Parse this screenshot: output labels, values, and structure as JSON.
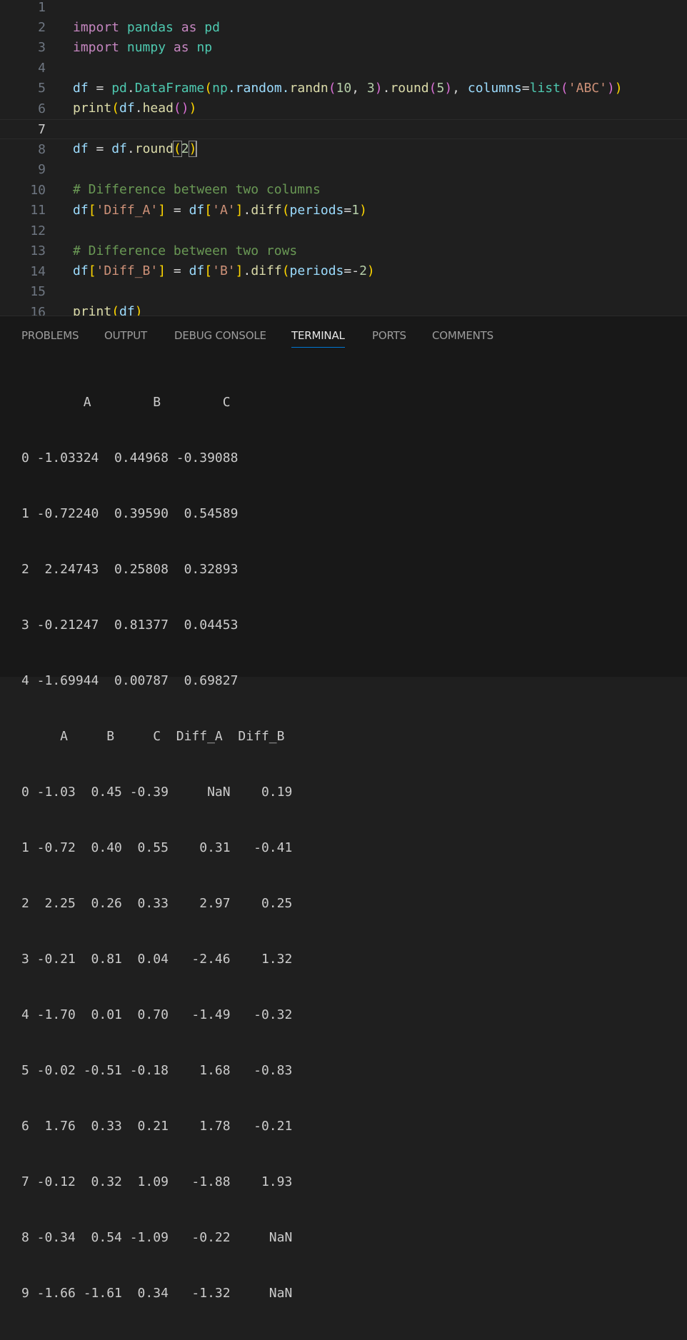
{
  "editor": {
    "line_numbers": [
      "1",
      "2",
      "3",
      "4",
      "5",
      "6",
      "7",
      "8",
      "9",
      "10",
      "11",
      "12",
      "13",
      "14",
      "15",
      "16"
    ],
    "active_line": "7",
    "lines": {
      "l1": {
        "t1": "import",
        "t2": "pandas",
        "t3": "as",
        "t4": "pd"
      },
      "l2": {
        "t1": "import",
        "t2": "numpy",
        "t3": "as",
        "t4": "np"
      },
      "l4": {
        "t1": "df",
        "t2": " = ",
        "t3": "pd",
        "t4": ".",
        "t5": "DataFrame",
        "t6": "(",
        "t7": "np",
        "t8": ".random.",
        "t9": "randn",
        "t10": "(",
        "t11": "10",
        "t12": ", ",
        "t13": "3",
        "t14": ")",
        "t15": ".",
        "t16": "round",
        "t17": "(",
        "t18": "5",
        "t19": ")",
        "t20": ", ",
        "t21": "columns",
        "t22": "=",
        "t23": "list",
        "t24": "(",
        "t25": "'ABC'",
        "t26": ")",
        "t27": ")"
      },
      "l5": {
        "t1": "print",
        "t2": "(",
        "t3": "df",
        "t4": ".",
        "t5": "head",
        "t6": "()",
        "t7": ")"
      },
      "l7": {
        "t1": "df",
        "t2": " = ",
        "t3": "df",
        "t4": ".",
        "t5": "round",
        "t6": "(",
        "t7": "2",
        "t8": ")"
      },
      "l9": {
        "t1": "# Difference between two columns"
      },
      "l10": {
        "t1": "df",
        "t2": "[",
        "t3": "'Diff_A'",
        "t4": "]",
        "t5": " = ",
        "t6": "df",
        "t7": "[",
        "t8": "'A'",
        "t9": "]",
        "t10": ".",
        "t11": "diff",
        "t12": "(",
        "t13": "periods",
        "t14": "=",
        "t15": "1",
        "t16": ")"
      },
      "l12": {
        "t1": "# Difference between two rows"
      },
      "l13": {
        "t1": "df",
        "t2": "[",
        "t3": "'Diff_B'",
        "t4": "]",
        "t5": " = ",
        "t6": "df",
        "t7": "[",
        "t8": "'B'",
        "t9": "]",
        "t10": ".",
        "t11": "diff",
        "t12": "(",
        "t13": "periods",
        "t14": "=-",
        "t15": "2",
        "t16": ")"
      },
      "l15": {
        "t1": "print",
        "t2": "(",
        "t3": "df",
        "t4": ")"
      }
    }
  },
  "panel": {
    "tabs": [
      "PROBLEMS",
      "OUTPUT",
      "DEBUG CONSOLE",
      "TERMINAL",
      "PORTS",
      "COMMENTS"
    ],
    "active_tab": "TERMINAL"
  },
  "terminal": {
    "lines": [
      "        A        B        C",
      "0 -1.03324  0.44968 -0.39088",
      "1 -0.72240  0.39590  0.54589",
      "2  2.24743  0.25808  0.32893",
      "3 -0.21247  0.81377  0.04453",
      "4 -1.69944  0.00787  0.69827",
      "     A     B     C  Diff_A  Diff_B",
      "0 -1.03  0.45 -0.39     NaN    0.19",
      "1 -0.72  0.40  0.55    0.31   -0.41",
      "2  2.25  0.26  0.33    2.97    0.25",
      "3 -0.21  0.81  0.04   -2.46    1.32",
      "4 -1.70  0.01  0.70   -1.49   -0.32",
      "5 -0.02 -0.51 -0.18    1.68   -0.83",
      "6  1.76  0.33  0.21    1.78   -0.21",
      "7 -0.12  0.32  1.09   -1.88    1.93",
      "8 -0.34  0.54 -1.09   -0.22     NaN",
      "9 -1.66 -1.61  0.34   -1.32     NaN"
    ]
  },
  "colors": {
    "editor_bg": "#1f1f1f",
    "panel_bg": "#181818",
    "keyword": "#c586c0",
    "module": "#4ec9b0",
    "variable": "#9cdcfe",
    "function": "#dcdcaa",
    "number": "#b5cea8",
    "string": "#ce9178",
    "comment": "#6a9955",
    "tab_underline": "#0078d4"
  }
}
